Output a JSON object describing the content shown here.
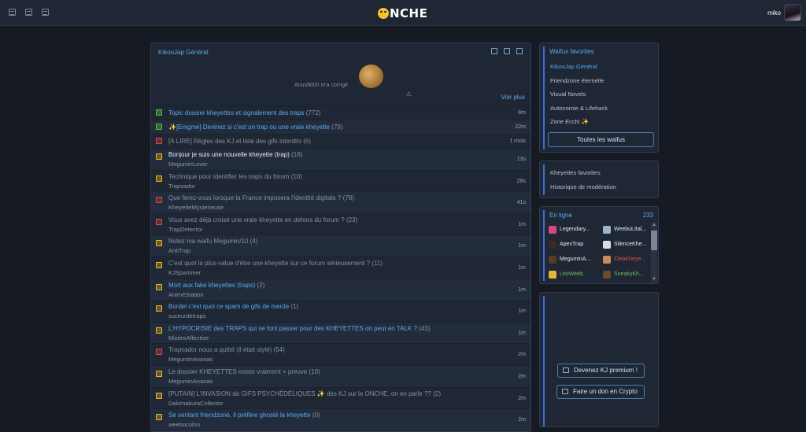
{
  "header": {
    "logo_text": "NCHE",
    "username": "miko",
    "left_icons": [
      "grid-icon",
      "grid-icon",
      "grid-icon"
    ]
  },
  "main": {
    "title": "KikooJap Général",
    "header_icons": [
      "grid-icon",
      "grid-icon",
      "grid-icon"
    ],
    "hero_text": "Anus9000 m'a corrigé.",
    "hero_mark": "⚠",
    "voir_plus": "Voir plus",
    "topics": [
      {
        "title": "Topic dossier kheyettes et signalement des traps",
        "count": "(772)",
        "author": "",
        "time": "8m",
        "icon": "green",
        "color": "link"
      },
      {
        "title": "✨[Enigme] Devinez si c'est un trap ou une vraie kheyette",
        "count": "(79)",
        "author": "",
        "time": "22m",
        "icon": "green",
        "color": "link"
      },
      {
        "title": "[À LIRE] Règles des KJ et liste des gifs interdits",
        "count": "(6)",
        "author": "",
        "time": "1 mois",
        "icon": "red",
        "color": "gray"
      },
      {
        "title": "Bonjour je suis une nouvelle kheyette (trap)",
        "count": "(16)",
        "author": "MeguminLover",
        "time": "13s",
        "icon": "yellow",
        "color": "white"
      },
      {
        "title": "Technique pour identifier les traps du forum",
        "count": "(10)",
        "author": "Trapvador",
        "time": "28s",
        "icon": "yellow",
        "color": "gray"
      },
      {
        "title": "Que ferez-vous lorsque la France imposera l'identité digitale ?",
        "count": "(78)",
        "author": "KheyetteMysterieuse",
        "time": "41s",
        "icon": "red",
        "color": "gray"
      },
      {
        "title": "Vous avez déjà croisé une vraie kheyette en dehors du forum ?",
        "count": "(23)",
        "author": "TrapDetector",
        "time": "1m",
        "icon": "red",
        "color": "gray"
      },
      {
        "title": "Notez ma waifu Megumin/10",
        "count": "(4)",
        "author": "AntiTrap",
        "time": "1m",
        "icon": "yellow",
        "color": "gray"
      },
      {
        "title": "C'est quoi la plus-value d'être une kheyette sur ce forum sérieusement ?",
        "count": "(11)",
        "author": "KJSpammer",
        "time": "1m",
        "icon": "yellow",
        "color": "gray"
      },
      {
        "title": "Mort aux fake kheyettes (traps)",
        "count": "(2)",
        "author": "AniméStation",
        "time": "1m",
        "icon": "yellow",
        "color": "link"
      },
      {
        "title": "Bordel c'est quoi ce spam de gifs de merde",
        "count": "(1)",
        "author": "suceurdetraps",
        "time": "1m",
        "icon": "yellow",
        "color": "link"
      },
      {
        "title": "L'HYPOCRISIE des TRAPS qui se font passer pour des KHEYETTES on peut en TALK ?",
        "count": "(43)",
        "author": "MisèreAffective",
        "time": "1m",
        "icon": "yellow",
        "color": "link"
      },
      {
        "title": "Trapvador nous a quitté (il était stylé)",
        "count": "(54)",
        "author": "MeguminAnanas",
        "time": "2m",
        "icon": "red",
        "color": "gray"
      },
      {
        "title": "Le dossier KHEYETTES existe vraiment + preuve",
        "count": "(10)",
        "author": "MeguminAnanas",
        "time": "2m",
        "icon": "yellow",
        "color": "gray"
      },
      {
        "title": "[PUTAIN] L'INVASION de GIFS PSYCHÉDÉLIQUES ✨ des KJ sur le ONCHE, on en parle ??",
        "count": "(2)",
        "author": "DakimakuraCollector",
        "time": "2m",
        "icon": "yellow",
        "color": "gray"
      },
      {
        "title": "Se sentant friendzoné, il préfère ghosté la kheyette",
        "count": "(0)",
        "author": "weebocolon",
        "time": "2m",
        "icon": "yellow",
        "color": "link"
      }
    ]
  },
  "waifus": {
    "title": "Waifus favorites",
    "items": [
      "KikooJap Général",
      "Friendzone éternelle",
      "Visual Novels",
      "Autonomie & Lifehack",
      "Zone Ecchi ✨"
    ],
    "button": "Toutes les waifus"
  },
  "links": {
    "items": [
      "Kheyettes favorites",
      "Historique de modération"
    ]
  },
  "online": {
    "title": "En ligne",
    "count": "233",
    "users": [
      {
        "name": "Legendary...",
        "color": "#e6ebf2",
        "avatar": "#d9487a"
      },
      {
        "name": "WeebuLItal...",
        "color": "#e6ebf2",
        "avatar": "#9bb4cc"
      },
      {
        "name": "ApexTrap",
        "color": "#e6ebf2",
        "avatar": "#3a2a2a"
      },
      {
        "name": "SilenceKhe...",
        "color": "#e6ebf2",
        "avatar": "#d8dde6"
      },
      {
        "name": "MeguminA...",
        "color": "#e6ebf2",
        "avatar": "#5a3a20"
      },
      {
        "name": "CleaKheye...",
        "color": "#e0534f",
        "avatar": "#c98a5a"
      },
      {
        "name": "LéoWeeb",
        "color": "#6bbf59",
        "avatar": "#e0b83a"
      },
      {
        "name": "SneakyKh...",
        "color": "#6bbf59",
        "avatar": "#6a4a2a"
      }
    ]
  },
  "premium": {
    "premium_button": "Devenez KJ premium !",
    "donate_button": "Faire un don en Crypto"
  }
}
